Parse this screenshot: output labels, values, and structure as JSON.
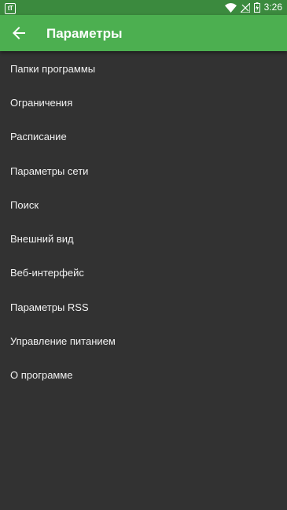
{
  "status_bar": {
    "app_badge": "tT",
    "time": "3:26",
    "icons": [
      "wifi-icon",
      "signal-icon",
      "battery-icon"
    ]
  },
  "app_bar": {
    "back_icon": "arrow-left-icon",
    "title": "Параметры"
  },
  "menu": {
    "items": [
      {
        "label": "Папки программы"
      },
      {
        "label": "Ограничения"
      },
      {
        "label": "Расписание"
      },
      {
        "label": "Параметры сети"
      },
      {
        "label": "Поиск"
      },
      {
        "label": "Внешний вид"
      },
      {
        "label": "Веб-интерфейс"
      },
      {
        "label": "Параметры RSS"
      },
      {
        "label": "Управление питанием"
      },
      {
        "label": "О программе"
      }
    ]
  },
  "colors": {
    "status_bar": "#3b8a3e",
    "app_bar": "#4caf50",
    "background": "#323232",
    "text": "#f2f2f2"
  }
}
